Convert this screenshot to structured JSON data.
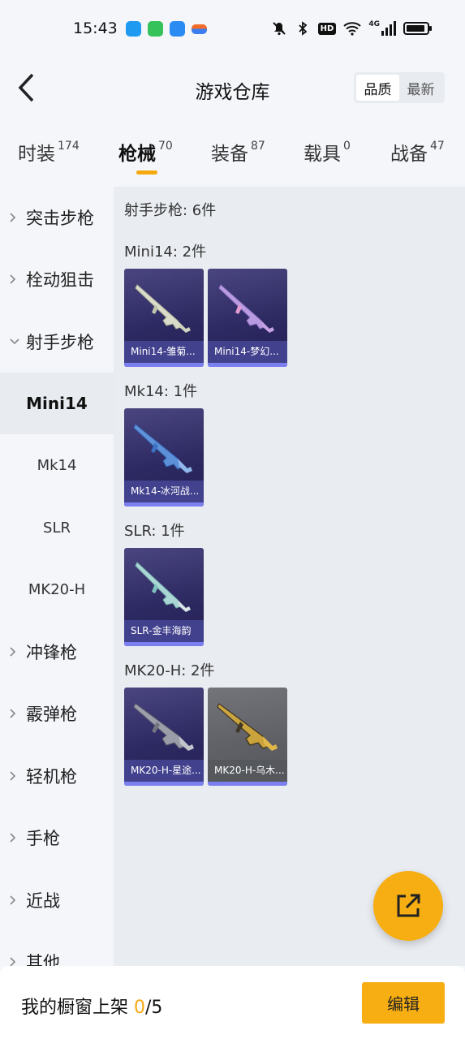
{
  "status_bar": {
    "time": "15:43",
    "icons": [
      "wallet-app-icon",
      "wechat-app-icon",
      "qq-app-icon",
      "notification-app-icon",
      "mute-icon",
      "bluetooth-icon",
      "hd-icon",
      "wifi-icon",
      "signal-4g-icon",
      "battery-icon"
    ],
    "hd_label": "HD",
    "net_label": "4G"
  },
  "header": {
    "title": "游戏仓库",
    "back_icon": "chevron-left-icon",
    "sort": {
      "options": [
        "品质",
        "最新"
      ],
      "selected": "品质"
    }
  },
  "tabs": [
    {
      "label": "时装",
      "count": "174"
    },
    {
      "label": "枪械",
      "count": "70",
      "active": true
    },
    {
      "label": "装备",
      "count": "87"
    },
    {
      "label": "载具",
      "count": "0"
    },
    {
      "label": "战备",
      "count": "47"
    }
  ],
  "sidebar": {
    "categories": [
      {
        "label": "突击步枪"
      },
      {
        "label": "栓动狙击"
      },
      {
        "label": "射手步枪",
        "expanded": true
      },
      {
        "label": "冲锋枪"
      },
      {
        "label": "霰弹枪"
      },
      {
        "label": "轻机枪"
      },
      {
        "label": "手枪"
      },
      {
        "label": "近战"
      },
      {
        "label": "其他"
      }
    ],
    "subitems": [
      {
        "label": "Mini14",
        "active": true
      },
      {
        "label": "Mk14"
      },
      {
        "label": "SLR"
      },
      {
        "label": "MK20-H"
      }
    ]
  },
  "content": {
    "summary": "射手步枪: 6件",
    "sections": [
      {
        "title": "Mini14: 2件",
        "items": [
          {
            "name": "Mini14-雏菊...",
            "rarity": "purple"
          },
          {
            "name": "Mini14-梦幻...",
            "rarity": "purple"
          }
        ]
      },
      {
        "title": "Mk14: 1件",
        "items": [
          {
            "name": "Mk14-冰河战...",
            "rarity": "purple"
          }
        ]
      },
      {
        "title": "SLR: 1件",
        "items": [
          {
            "name": "SLR-金丰海韵",
            "rarity": "purple"
          }
        ]
      },
      {
        "title": "MK20-H: 2件",
        "items": [
          {
            "name": "MK20-H-星途...",
            "rarity": "purple"
          },
          {
            "name": "MK20-H-乌木...",
            "rarity": "gray"
          }
        ]
      }
    ]
  },
  "fab": {
    "icon": "share-external-icon"
  },
  "bottom": {
    "shop_label": "我的橱窗上架 ",
    "shop_used": "0",
    "shop_total": "/5",
    "edit_label": "编辑"
  },
  "colors": {
    "accent": "#f6ae12",
    "card_purple": "#2c2861",
    "card_gray": "#55575c",
    "card_accent": "#7c7ff0"
  }
}
